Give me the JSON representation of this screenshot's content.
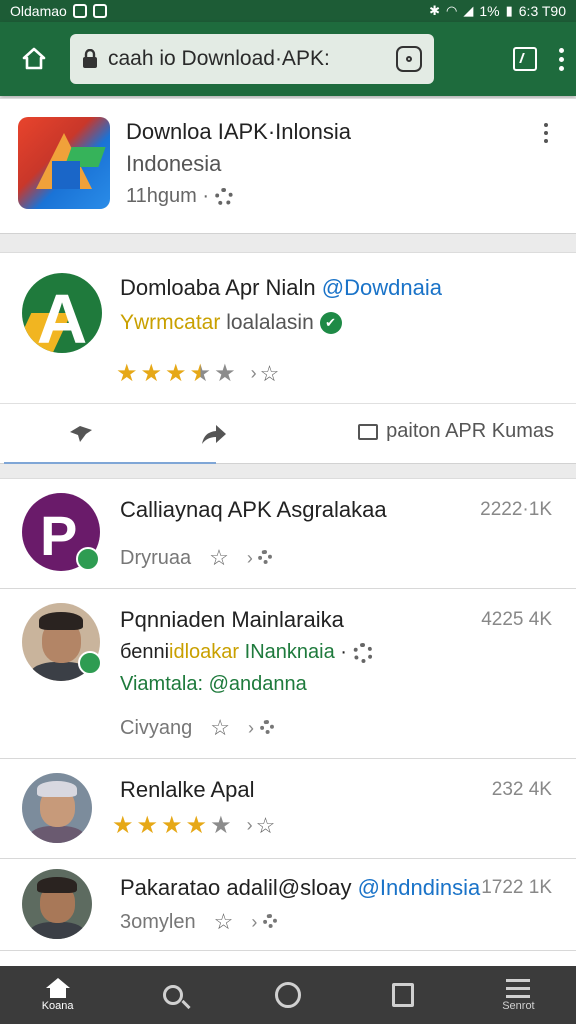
{
  "status_bar": {
    "left_text": "Oldamao",
    "right_text": "1%",
    "time": "6:3 T90"
  },
  "toolbar": {
    "url": "caah io Download·APK:"
  },
  "app_card": {
    "title": "Downloa IAPK·Inlonsia",
    "subtitle": "Indonesia",
    "meta": "11hgum ·"
  },
  "post_card": {
    "title_part1": "Domloaba Apr Nialn ",
    "title_part2": "@Dowdnaia",
    "subtitle_part1": "Ywrmcatar ",
    "subtitle_part2": "loalalasin",
    "rating": 3.5,
    "action_label": "paiton APR Kumas"
  },
  "list": [
    {
      "title": "Calliaynaq APK Asgralakaa",
      "count": "2222·1K",
      "meta": "Dryruaa"
    },
    {
      "title": "Pqnniaden Mainlaraika",
      "count": "4225 4K",
      "line2_a": "беnni",
      "line2_b": "idloakar",
      "line2_c": " INanknaia",
      "line2_d": " ·",
      "line3": "Viamtala: @andanna",
      "meta": "Civyang"
    },
    {
      "title": "Renlalke Apal",
      "count": "232 4K",
      "rating": 4
    },
    {
      "title_part1": "Pakaratao adalil@sloay ",
      "title_part2": "@Indndinsia",
      "count": "1722 1K",
      "meta": "3omylen"
    }
  ],
  "bottom_nav": [
    {
      "label": "Koana",
      "icon": "home-icon"
    },
    {
      "label": "",
      "icon": "search-icon"
    },
    {
      "label": "",
      "icon": "circle-icon"
    },
    {
      "label": "",
      "icon": "bookmark-icon"
    },
    {
      "label": "Senrot",
      "icon": "menu-icon"
    }
  ],
  "colors": {
    "toolbar": "#1e6b3d",
    "star": "#e6a817",
    "nav": "#3b3b3b"
  }
}
